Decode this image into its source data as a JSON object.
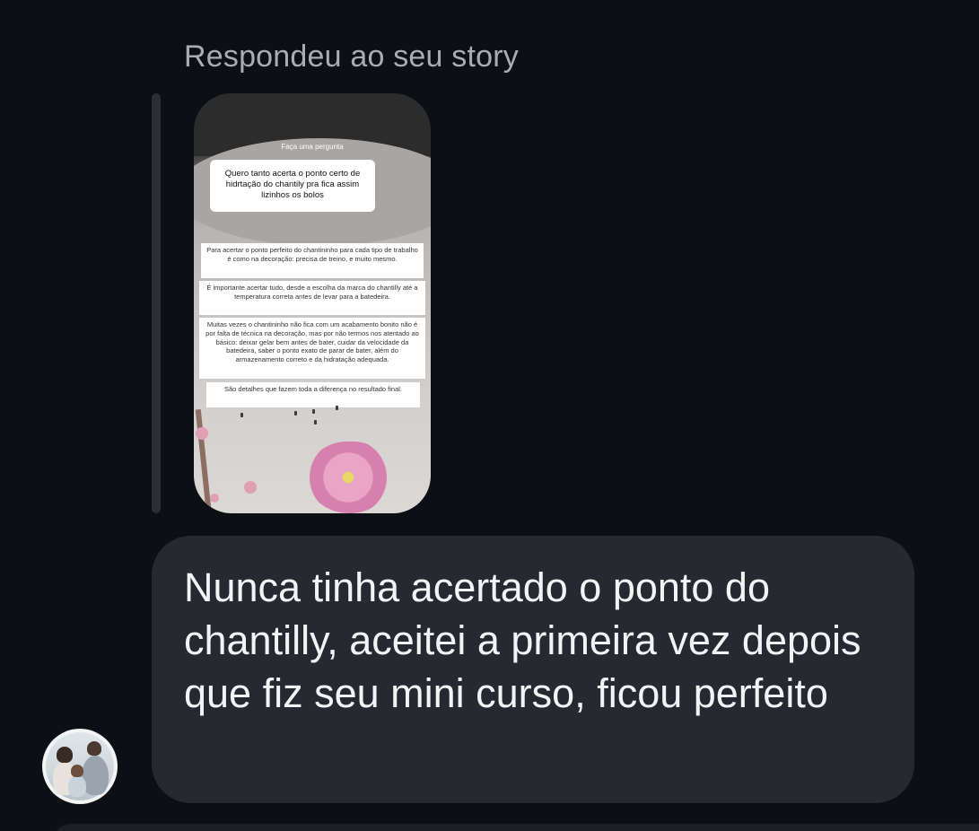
{
  "reply_context": "Respondeu ao seu story",
  "story": {
    "header": "Faça uma pergunta",
    "question": "Quero tanto acerta o ponto certo de hidrtação do chantily pra fica assim lizinhos os bolos",
    "answers": [
      "Para acertar o ponto perfeito do chantininho para cada tipo de trabalho é como na decoração: precisa de treino, e muito mesmo.",
      "É importante acertar tudo, desde a escolha da marca do chantilly até a temperatura correta antes de levar para a batedeira.",
      "Muitas vezes o chantininho não fica com um acabamento bonito não é por falta de técnica na decoração, mas por não termos nos atentado ao básico: deixar gelar bem antes de bater, cuidar da velocidade da batedeira, saber o ponto exato de parar de bater, além do armazenamento correto e da hidratação adequada.",
      "São detalhes que fazem toda a diferença no resultado final."
    ]
  },
  "message": {
    "text": "Nunca tinha acertado o ponto do chantilly, aceitei a primeira vez depois que fiz seu mini curso, ficou perfeito"
  },
  "colors": {
    "background": "#0c1014",
    "bubble": "#262a30",
    "quote_bar": "#2a2f35",
    "muted_text": "#a8adb3"
  }
}
